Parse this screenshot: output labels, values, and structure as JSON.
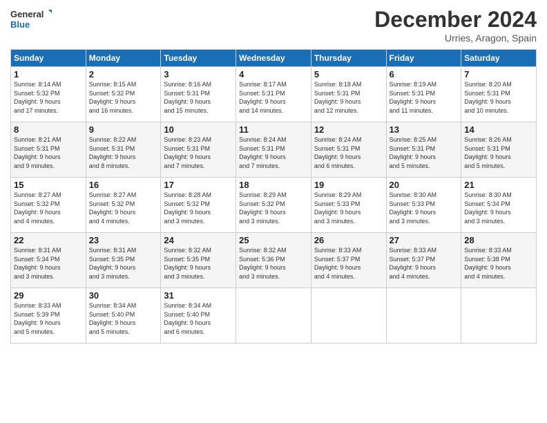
{
  "logo": {
    "line1": "General",
    "line2": "Blue"
  },
  "header": {
    "title": "December 2024",
    "location": "Urries, Aragon, Spain"
  },
  "weekdays": [
    "Sunday",
    "Monday",
    "Tuesday",
    "Wednesday",
    "Thursday",
    "Friday",
    "Saturday"
  ],
  "weeks": [
    [
      {
        "day": "1",
        "info": "Sunrise: 8:14 AM\nSunset: 5:32 PM\nDaylight: 9 hours\nand 17 minutes."
      },
      {
        "day": "2",
        "info": "Sunrise: 8:15 AM\nSunset: 5:32 PM\nDaylight: 9 hours\nand 16 minutes."
      },
      {
        "day": "3",
        "info": "Sunrise: 8:16 AM\nSunset: 5:31 PM\nDaylight: 9 hours\nand 15 minutes."
      },
      {
        "day": "4",
        "info": "Sunrise: 8:17 AM\nSunset: 5:31 PM\nDaylight: 9 hours\nand 14 minutes."
      },
      {
        "day": "5",
        "info": "Sunrise: 8:18 AM\nSunset: 5:31 PM\nDaylight: 9 hours\nand 12 minutes."
      },
      {
        "day": "6",
        "info": "Sunrise: 8:19 AM\nSunset: 5:31 PM\nDaylight: 9 hours\nand 11 minutes."
      },
      {
        "day": "7",
        "info": "Sunrise: 8:20 AM\nSunset: 5:31 PM\nDaylight: 9 hours\nand 10 minutes."
      }
    ],
    [
      {
        "day": "8",
        "info": "Sunrise: 8:21 AM\nSunset: 5:31 PM\nDaylight: 9 hours\nand 9 minutes."
      },
      {
        "day": "9",
        "info": "Sunrise: 8:22 AM\nSunset: 5:31 PM\nDaylight: 9 hours\nand 8 minutes."
      },
      {
        "day": "10",
        "info": "Sunrise: 8:23 AM\nSunset: 5:31 PM\nDaylight: 9 hours\nand 7 minutes."
      },
      {
        "day": "11",
        "info": "Sunrise: 8:24 AM\nSunset: 5:31 PM\nDaylight: 9 hours\nand 7 minutes."
      },
      {
        "day": "12",
        "info": "Sunrise: 8:24 AM\nSunset: 5:31 PM\nDaylight: 9 hours\nand 6 minutes."
      },
      {
        "day": "13",
        "info": "Sunrise: 8:25 AM\nSunset: 5:31 PM\nDaylight: 9 hours\nand 5 minutes."
      },
      {
        "day": "14",
        "info": "Sunrise: 8:26 AM\nSunset: 5:31 PM\nDaylight: 9 hours\nand 5 minutes."
      }
    ],
    [
      {
        "day": "15",
        "info": "Sunrise: 8:27 AM\nSunset: 5:32 PM\nDaylight: 9 hours\nand 4 minutes."
      },
      {
        "day": "16",
        "info": "Sunrise: 8:27 AM\nSunset: 5:32 PM\nDaylight: 9 hours\nand 4 minutes."
      },
      {
        "day": "17",
        "info": "Sunrise: 8:28 AM\nSunset: 5:32 PM\nDaylight: 9 hours\nand 3 minutes."
      },
      {
        "day": "18",
        "info": "Sunrise: 8:29 AM\nSunset: 5:32 PM\nDaylight: 9 hours\nand 3 minutes."
      },
      {
        "day": "19",
        "info": "Sunrise: 8:29 AM\nSunset: 5:33 PM\nDaylight: 9 hours\nand 3 minutes."
      },
      {
        "day": "20",
        "info": "Sunrise: 8:30 AM\nSunset: 5:33 PM\nDaylight: 9 hours\nand 3 minutes."
      },
      {
        "day": "21",
        "info": "Sunrise: 8:30 AM\nSunset: 5:34 PM\nDaylight: 9 hours\nand 3 minutes."
      }
    ],
    [
      {
        "day": "22",
        "info": "Sunrise: 8:31 AM\nSunset: 5:34 PM\nDaylight: 9 hours\nand 3 minutes."
      },
      {
        "day": "23",
        "info": "Sunrise: 8:31 AM\nSunset: 5:35 PM\nDaylight: 9 hours\nand 3 minutes."
      },
      {
        "day": "24",
        "info": "Sunrise: 8:32 AM\nSunset: 5:35 PM\nDaylight: 9 hours\nand 3 minutes."
      },
      {
        "day": "25",
        "info": "Sunrise: 8:32 AM\nSunset: 5:36 PM\nDaylight: 9 hours\nand 3 minutes."
      },
      {
        "day": "26",
        "info": "Sunrise: 8:33 AM\nSunset: 5:37 PM\nDaylight: 9 hours\nand 4 minutes."
      },
      {
        "day": "27",
        "info": "Sunrise: 8:33 AM\nSunset: 5:37 PM\nDaylight: 9 hours\nand 4 minutes."
      },
      {
        "day": "28",
        "info": "Sunrise: 8:33 AM\nSunset: 5:38 PM\nDaylight: 9 hours\nand 4 minutes."
      }
    ],
    [
      {
        "day": "29",
        "info": "Sunrise: 8:33 AM\nSunset: 5:39 PM\nDaylight: 9 hours\nand 5 minutes."
      },
      {
        "day": "30",
        "info": "Sunrise: 8:34 AM\nSunset: 5:40 PM\nDaylight: 9 hours\nand 5 minutes."
      },
      {
        "day": "31",
        "info": "Sunrise: 8:34 AM\nSunset: 5:40 PM\nDaylight: 9 hours\nand 6 minutes."
      },
      null,
      null,
      null,
      null
    ]
  ]
}
